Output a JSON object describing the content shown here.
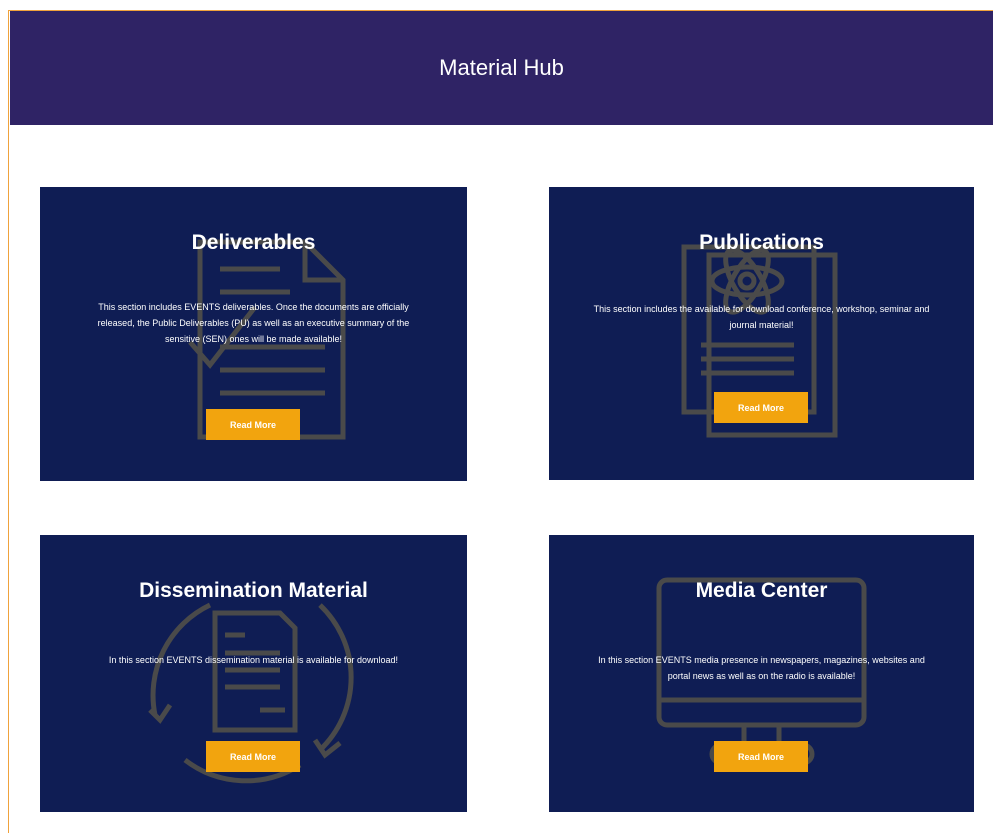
{
  "header": {
    "title": "Material Hub"
  },
  "cards": [
    {
      "title": "Deliverables",
      "description": "This section includes EVENTS deliverables. Once the documents are officially released, the Public Deliverables (PU) as well as an executive summary of the sensitive (SEN) ones will be made available!",
      "button_label": "Read More",
      "icon": "document-check-icon"
    },
    {
      "title": "Publications",
      "description": "This section includes the available for download conference, workshop, seminar and journal material!",
      "button_label": "Read More",
      "icon": "atom-document-icon"
    },
    {
      "title": "Dissemination Material",
      "description": "In this section EVENTS dissemination material is available for download!",
      "button_label": "Read More",
      "icon": "document-cycle-icon"
    },
    {
      "title": "Media Center",
      "description": "In this section EVENTS media presence in newspapers, magazines, websites and portal news as well as on the radio is available!",
      "button_label": "Read More",
      "icon": "monitor-icon"
    }
  ],
  "colors": {
    "header_bg": "#2f2365",
    "card_bg": "#0f1d54",
    "button_bg": "#f2a40e",
    "frame_border": "#f0a23c",
    "icon_stroke": "#4a4a4a"
  }
}
